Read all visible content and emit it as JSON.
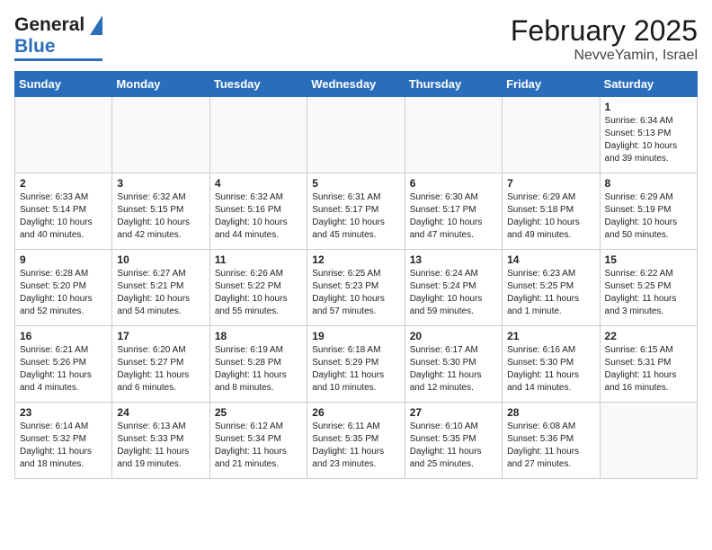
{
  "header": {
    "logo": {
      "part1": "General",
      "part2": "Blue"
    },
    "month": "February 2025",
    "location": "NevveYamin, Israel"
  },
  "weekdays": [
    "Sunday",
    "Monday",
    "Tuesday",
    "Wednesday",
    "Thursday",
    "Friday",
    "Saturday"
  ],
  "weeks": [
    [
      {
        "day": "",
        "info": ""
      },
      {
        "day": "",
        "info": ""
      },
      {
        "day": "",
        "info": ""
      },
      {
        "day": "",
        "info": ""
      },
      {
        "day": "",
        "info": ""
      },
      {
        "day": "",
        "info": ""
      },
      {
        "day": "1",
        "info": "Sunrise: 6:34 AM\nSunset: 5:13 PM\nDaylight: 10 hours\nand 39 minutes."
      }
    ],
    [
      {
        "day": "2",
        "info": "Sunrise: 6:33 AM\nSunset: 5:14 PM\nDaylight: 10 hours\nand 40 minutes."
      },
      {
        "day": "3",
        "info": "Sunrise: 6:32 AM\nSunset: 5:15 PM\nDaylight: 10 hours\nand 42 minutes."
      },
      {
        "day": "4",
        "info": "Sunrise: 6:32 AM\nSunset: 5:16 PM\nDaylight: 10 hours\nand 44 minutes."
      },
      {
        "day": "5",
        "info": "Sunrise: 6:31 AM\nSunset: 5:17 PM\nDaylight: 10 hours\nand 45 minutes."
      },
      {
        "day": "6",
        "info": "Sunrise: 6:30 AM\nSunset: 5:17 PM\nDaylight: 10 hours\nand 47 minutes."
      },
      {
        "day": "7",
        "info": "Sunrise: 6:29 AM\nSunset: 5:18 PM\nDaylight: 10 hours\nand 49 minutes."
      },
      {
        "day": "8",
        "info": "Sunrise: 6:29 AM\nSunset: 5:19 PM\nDaylight: 10 hours\nand 50 minutes."
      }
    ],
    [
      {
        "day": "9",
        "info": "Sunrise: 6:28 AM\nSunset: 5:20 PM\nDaylight: 10 hours\nand 52 minutes."
      },
      {
        "day": "10",
        "info": "Sunrise: 6:27 AM\nSunset: 5:21 PM\nDaylight: 10 hours\nand 54 minutes."
      },
      {
        "day": "11",
        "info": "Sunrise: 6:26 AM\nSunset: 5:22 PM\nDaylight: 10 hours\nand 55 minutes."
      },
      {
        "day": "12",
        "info": "Sunrise: 6:25 AM\nSunset: 5:23 PM\nDaylight: 10 hours\nand 57 minutes."
      },
      {
        "day": "13",
        "info": "Sunrise: 6:24 AM\nSunset: 5:24 PM\nDaylight: 10 hours\nand 59 minutes."
      },
      {
        "day": "14",
        "info": "Sunrise: 6:23 AM\nSunset: 5:25 PM\nDaylight: 11 hours\nand 1 minute."
      },
      {
        "day": "15",
        "info": "Sunrise: 6:22 AM\nSunset: 5:25 PM\nDaylight: 11 hours\nand 3 minutes."
      }
    ],
    [
      {
        "day": "16",
        "info": "Sunrise: 6:21 AM\nSunset: 5:26 PM\nDaylight: 11 hours\nand 4 minutes."
      },
      {
        "day": "17",
        "info": "Sunrise: 6:20 AM\nSunset: 5:27 PM\nDaylight: 11 hours\nand 6 minutes."
      },
      {
        "day": "18",
        "info": "Sunrise: 6:19 AM\nSunset: 5:28 PM\nDaylight: 11 hours\nand 8 minutes."
      },
      {
        "day": "19",
        "info": "Sunrise: 6:18 AM\nSunset: 5:29 PM\nDaylight: 11 hours\nand 10 minutes."
      },
      {
        "day": "20",
        "info": "Sunrise: 6:17 AM\nSunset: 5:30 PM\nDaylight: 11 hours\nand 12 minutes."
      },
      {
        "day": "21",
        "info": "Sunrise: 6:16 AM\nSunset: 5:30 PM\nDaylight: 11 hours\nand 14 minutes."
      },
      {
        "day": "22",
        "info": "Sunrise: 6:15 AM\nSunset: 5:31 PM\nDaylight: 11 hours\nand 16 minutes."
      }
    ],
    [
      {
        "day": "23",
        "info": "Sunrise: 6:14 AM\nSunset: 5:32 PM\nDaylight: 11 hours\nand 18 minutes."
      },
      {
        "day": "24",
        "info": "Sunrise: 6:13 AM\nSunset: 5:33 PM\nDaylight: 11 hours\nand 19 minutes."
      },
      {
        "day": "25",
        "info": "Sunrise: 6:12 AM\nSunset: 5:34 PM\nDaylight: 11 hours\nand 21 minutes."
      },
      {
        "day": "26",
        "info": "Sunrise: 6:11 AM\nSunset: 5:35 PM\nDaylight: 11 hours\nand 23 minutes."
      },
      {
        "day": "27",
        "info": "Sunrise: 6:10 AM\nSunset: 5:35 PM\nDaylight: 11 hours\nand 25 minutes."
      },
      {
        "day": "28",
        "info": "Sunrise: 6:08 AM\nSunset: 5:36 PM\nDaylight: 11 hours\nand 27 minutes."
      },
      {
        "day": "",
        "info": ""
      }
    ]
  ]
}
